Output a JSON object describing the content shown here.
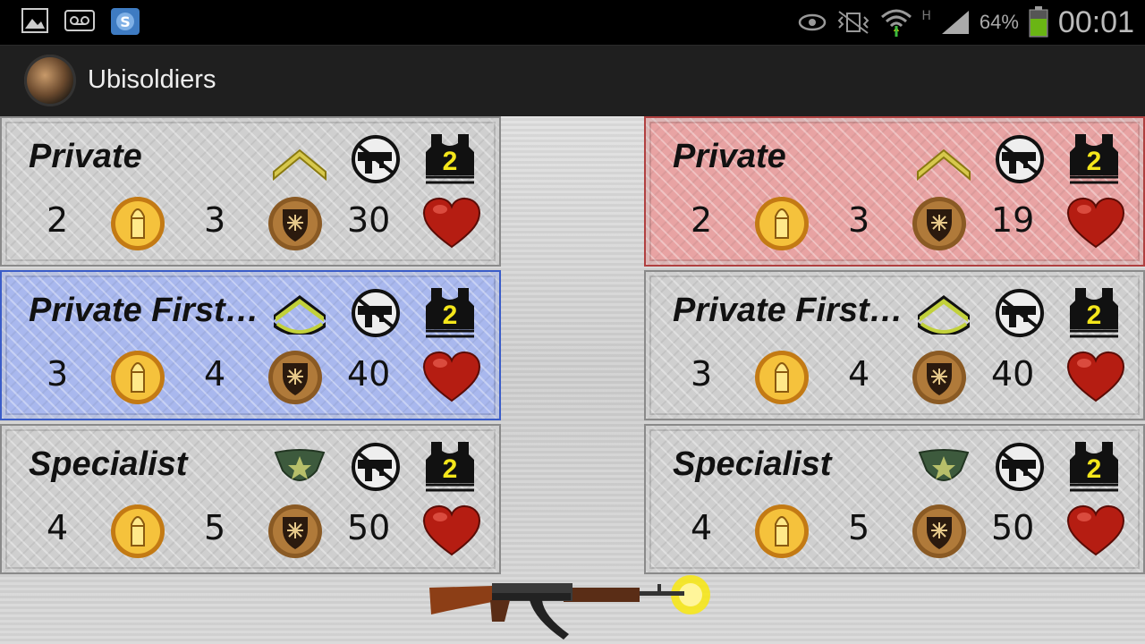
{
  "status_bar": {
    "battery_percent": "64%",
    "time": "00:01",
    "network_label": "H",
    "left_icons": [
      "gallery-icon",
      "voicemail-icon",
      "s-app-icon"
    ],
    "right_icons": [
      "eye-icon",
      "vibrate-mute-icon",
      "wifi-icon",
      "signal-icon",
      "battery-icon"
    ]
  },
  "action_bar": {
    "title": "Ubisoldiers"
  },
  "left_column": [
    {
      "name": "Private",
      "attack": "2",
      "defense": "3",
      "health": "30",
      "armor_level": "2",
      "rank": "private",
      "highlight": "none"
    },
    {
      "name": "Private First Class",
      "attack": "3",
      "defense": "4",
      "health": "40",
      "armor_level": "2",
      "rank": "private-first-class",
      "highlight": "blue"
    },
    {
      "name": "Specialist",
      "attack": "4",
      "defense": "5",
      "health": "50",
      "armor_level": "2",
      "rank": "specialist",
      "highlight": "none"
    }
  ],
  "right_column": [
    {
      "name": "Private",
      "attack": "2",
      "defense": "3",
      "health": "19",
      "armor_level": "2",
      "rank": "private",
      "highlight": "red"
    },
    {
      "name": "Private First Class",
      "attack": "3",
      "defense": "4",
      "health": "40",
      "armor_level": "2",
      "rank": "private-first-class",
      "highlight": "none"
    },
    {
      "name": "Specialist",
      "attack": "4",
      "defense": "5",
      "health": "50",
      "armor_level": "2",
      "rank": "specialist",
      "highlight": "none"
    }
  ],
  "colors": {
    "accent_red": "#e8a3a3",
    "accent_blue": "#a9b8ee"
  }
}
